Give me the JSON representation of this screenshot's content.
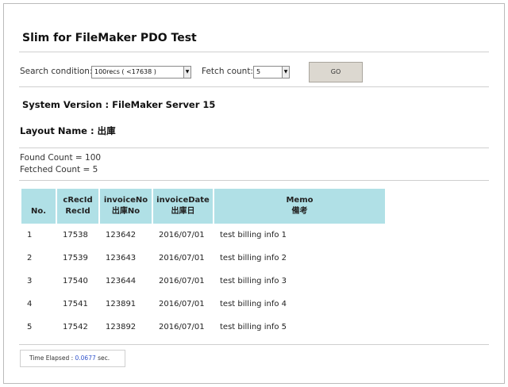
{
  "page_title": "Slim for FileMaker PDO Test",
  "search": {
    "condition_label": "Search condition:",
    "condition_value": "100recs ( <17638 )",
    "fetch_label": "Fetch count:",
    "fetch_value": "5",
    "go_label": "GO"
  },
  "system_version": "System Version : FileMaker Server 15",
  "layout_name": "Layout Name : 出庫",
  "found_count": "Found Count = 100",
  "fetched_count": "Fetched Count = 5",
  "table": {
    "headers": [
      {
        "line1": "No.",
        "line2": ""
      },
      {
        "line1": "cRecId",
        "line2": "RecId"
      },
      {
        "line1": "invoiceNo",
        "line2": "出庫No"
      },
      {
        "line1": "invoiceDate",
        "line2": "出庫日"
      },
      {
        "line1": "Memo",
        "line2": "備考"
      }
    ],
    "rows": [
      [
        "1",
        "17538",
        "123642",
        "2016/07/01",
        "test billing info 1"
      ],
      [
        "2",
        "17539",
        "123643",
        "2016/07/01",
        "test billing info 2"
      ],
      [
        "3",
        "17540",
        "123644",
        "2016/07/01",
        "test billing info 3"
      ],
      [
        "4",
        "17541",
        "123891",
        "2016/07/01",
        "test billing info 4"
      ],
      [
        "5",
        "17542",
        "123892",
        "2016/07/01",
        "test billing info 5"
      ]
    ]
  },
  "elapsed": {
    "label": "Time Elapsed : ",
    "value": "0.0677",
    "unit": " sec."
  },
  "colors": {
    "header_bg": "#b0e0e6",
    "elapsed_value": "#3355cc",
    "go_button_bg": "#dcd8d0"
  },
  "icons": {
    "dropdown": "chevron-down-icon"
  }
}
